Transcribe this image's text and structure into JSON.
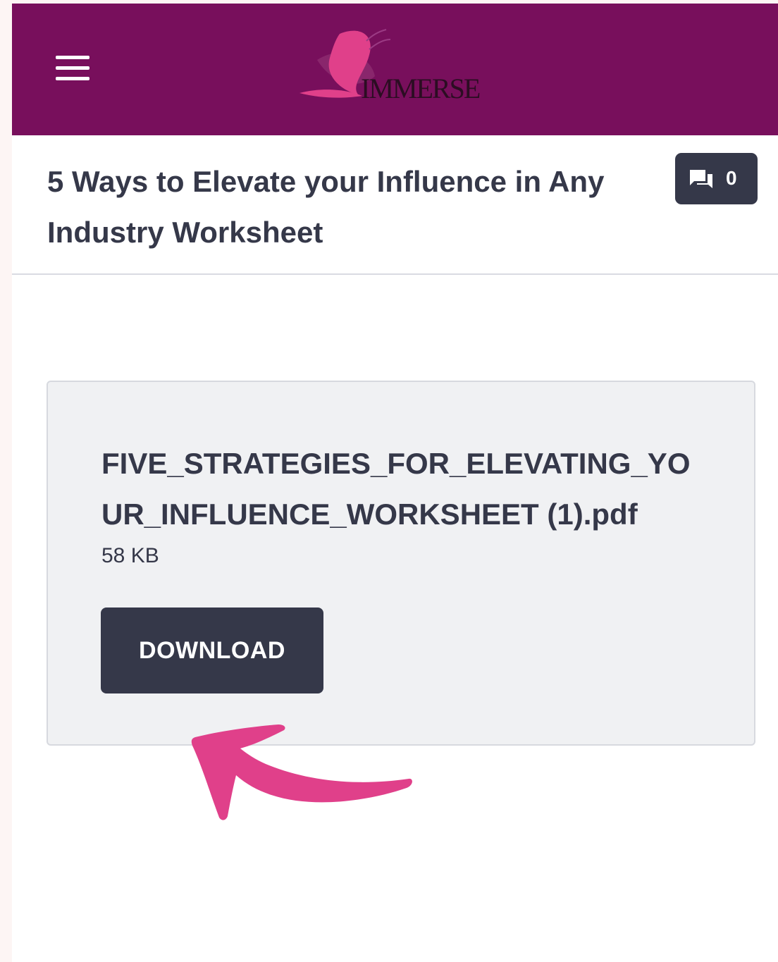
{
  "brand": {
    "logo_text": "IMMERSE",
    "bar_color": "#780f5c",
    "accent_color": "#e0408a"
  },
  "header": {
    "title": "5 Ways to Elevate your Influence in Any Industry Worksheet",
    "comment_count": "0",
    "comment_icon": "comments-icon"
  },
  "file": {
    "name": "FIVE_STRATEGIES_FOR_ELEVATING_YOUR_INFLUENCE_WORKSHEET (1).pdf",
    "size": "58 KB",
    "download_label": "DOWNLOAD"
  },
  "icons": {
    "menu": "hamburger-menu-icon",
    "annotation": "curved-arrow-icon"
  }
}
